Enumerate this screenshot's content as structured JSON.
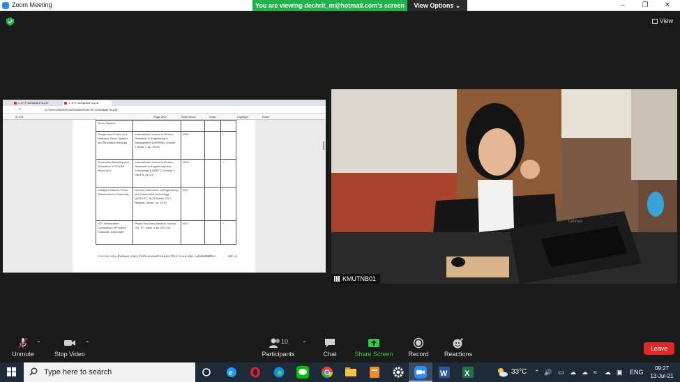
{
  "window": {
    "title": "Zoom Meeting"
  },
  "banner": {
    "viewing_text": "You are viewing dechrit_m@hotmail.com's screen",
    "view_options": "View Options"
  },
  "top_right": {
    "view_label": "View"
  },
  "shared_screen": {
    "browser": {
      "tabs": [
        {
          "label": "1. ตารางเสนอผลงาน.pdf"
        },
        {
          "label": "1. ตารางเสนอผลงาน.pdf"
        }
      ],
      "url": "C:/Users/DMS/Downloads/001ตารางเสนอผลงาน.pdf",
      "pdf_toolbar": {
        "page_of": "of 103",
        "page_view": "Page view",
        "read_aloud": "Read aloud",
        "draw": "Draw",
        "highlight": "Highlight",
        "erase": "Erase"
      }
    },
    "document": {
      "rows": [
        {
          "title": "Servo System",
          "journal": "",
          "year": "",
          "check": ""
        },
        {
          "title": "Design and Control of a Hydraulic Servo System and Simulation Analysis",
          "journal": "International Journal of Modern Research in Engineering & Management (IJMREM), Volume 1,Issue 7, pp. 29-40",
          "year": "2018",
          "check": "✓"
        },
        {
          "title": "Kinematics Modeling and Simulation of SCARA Robot Arm",
          "journal": "International Journal of Modern Research in Engineering and Technology (IJMRET), Volume 3 Issue 8, pp.1-6",
          "year": "2018",
          "check": "✓"
        },
        {
          "title": "Intelligent Electric Power Wheelchair for Physically",
          "journal": "Annual Conference on Engineering and Information Technology (ACEAIT), 28-31 March 2017, Nagoya, Japan. pp. 44-52",
          "year": "2017",
          "check": "✓"
        },
        {
          "title": "VDT Workstation: Comparison of Posture Computer Users with",
          "journal": "Royal Thai Army Medical Journal, Vol. 70 , Issue 4, pp.209-216",
          "year": "2017",
          "check": "✓"
        }
      ],
      "footer_left": "รายงานการประเมินตนเอง (SAR) สำหรับเสนอขอตำแหน่งทางวิชาการ พ.ศ.2564 ระดับบัณฑิตศึกษา",
      "footer_right": "หน้า 24"
    }
  },
  "video": {
    "participant_name": "KMUTNB01",
    "laptop_brand": "Lenovo"
  },
  "toolbar": {
    "unmute": "Unmute",
    "stop_video": "Stop Video",
    "participants": "Participants",
    "participants_count": "10",
    "chat": "Chat",
    "share_screen": "Share Screen",
    "record": "Record",
    "reactions": "Reactions",
    "leave": "Leave"
  },
  "taskbar": {
    "search_placeholder": "Type here to search",
    "weather": "33°C",
    "language": "ENG",
    "time": "09:27",
    "date": "13-Jul-21"
  },
  "colors": {
    "banner_green": "#23b14d",
    "share_green": "#2ecc40",
    "leave_red": "#e02828",
    "taskbar": "#1f2a38"
  }
}
